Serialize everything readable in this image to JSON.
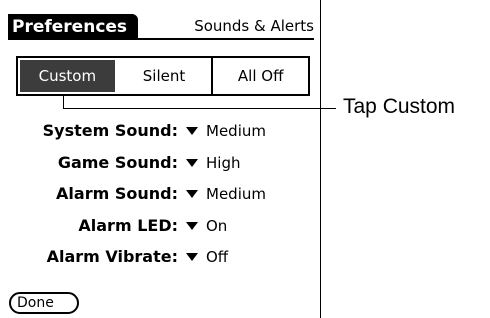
{
  "header": {
    "title": "Preferences",
    "panel": "Sounds & Alerts"
  },
  "profile_selector": {
    "options": [
      "Custom",
      "Silent",
      "All Off"
    ],
    "selected": "Custom"
  },
  "settings": [
    {
      "label": "System Sound:",
      "value": "Medium"
    },
    {
      "label": "Game Sound:",
      "value": "High"
    },
    {
      "label": "Alarm Sound:",
      "value": "Medium"
    },
    {
      "label": "Alarm LED:",
      "value": "On"
    },
    {
      "label": "Alarm Vibrate:",
      "value": "Off"
    }
  ],
  "footer": {
    "done_label": "Done"
  },
  "callout": {
    "text": "Tap Custom"
  },
  "colors": {
    "selected_bg": "#3c3c3c",
    "title_bg": "#000000"
  },
  "icons": {
    "picker_arrow": "triangle-down-icon"
  }
}
